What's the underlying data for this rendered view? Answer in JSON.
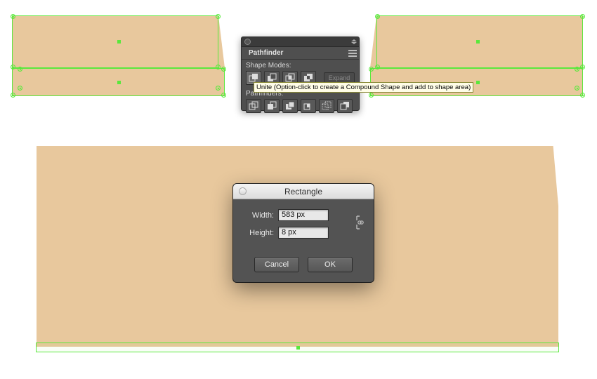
{
  "shapes": {
    "fill_color": "#e8c89d",
    "selection_color": "#5ae83c"
  },
  "pathfinder": {
    "title": "Pathfinder",
    "shape_modes_label": "Shape Modes:",
    "pathfinders_label": "Pathfinders:",
    "expand_label": "Expand",
    "shape_mode_buttons": [
      "unite",
      "minus-front",
      "intersect",
      "exclude"
    ],
    "pathfinder_buttons": [
      "divide",
      "trim",
      "merge",
      "crop",
      "outline",
      "minus-back"
    ],
    "tooltip": "Unite (Option-click to create a Compound Shape and add to shape area)"
  },
  "rectangle_dialog": {
    "title": "Rectangle",
    "width_label": "Width:",
    "height_label": "Height:",
    "width_value": "583 px",
    "height_value": "8 px",
    "cancel_label": "Cancel",
    "ok_label": "OK"
  }
}
